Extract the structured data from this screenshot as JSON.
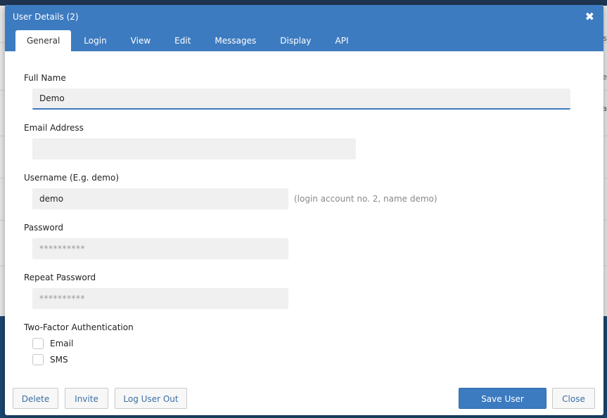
{
  "background": {
    "right_texts": [
      "s",
      "e",
      "a"
    ]
  },
  "dialog": {
    "title": "User Details (2)",
    "close_glyph": "✖"
  },
  "tabs": [
    {
      "label": "General",
      "active": true
    },
    {
      "label": "Login"
    },
    {
      "label": "View"
    },
    {
      "label": "Edit"
    },
    {
      "label": "Messages"
    },
    {
      "label": "Display"
    },
    {
      "label": "API"
    }
  ],
  "form": {
    "full_name": {
      "label": "Full Name",
      "value": "Demo"
    },
    "email": {
      "label": "Email Address",
      "value": ""
    },
    "username": {
      "label": "Username (E.g. demo)",
      "value": "demo",
      "hint": "(login account no. 2, name demo)"
    },
    "password": {
      "label": "Password",
      "value": "**********"
    },
    "repeat_password": {
      "label": "Repeat Password",
      "value": "**********"
    },
    "two_factor": {
      "label": "Two-Factor Authentication",
      "options": [
        {
          "label": "Email",
          "checked": false
        },
        {
          "label": "SMS",
          "checked": false
        }
      ]
    }
  },
  "footer": {
    "delete": "Delete",
    "invite": "Invite",
    "logout": "Log User Out",
    "save": "Save User",
    "close": "Close"
  },
  "colors": {
    "accent": "#3d7bc0",
    "field_bg": "#f0f0f0",
    "link_text": "#3a6ea5",
    "hint_text": "#888888"
  }
}
